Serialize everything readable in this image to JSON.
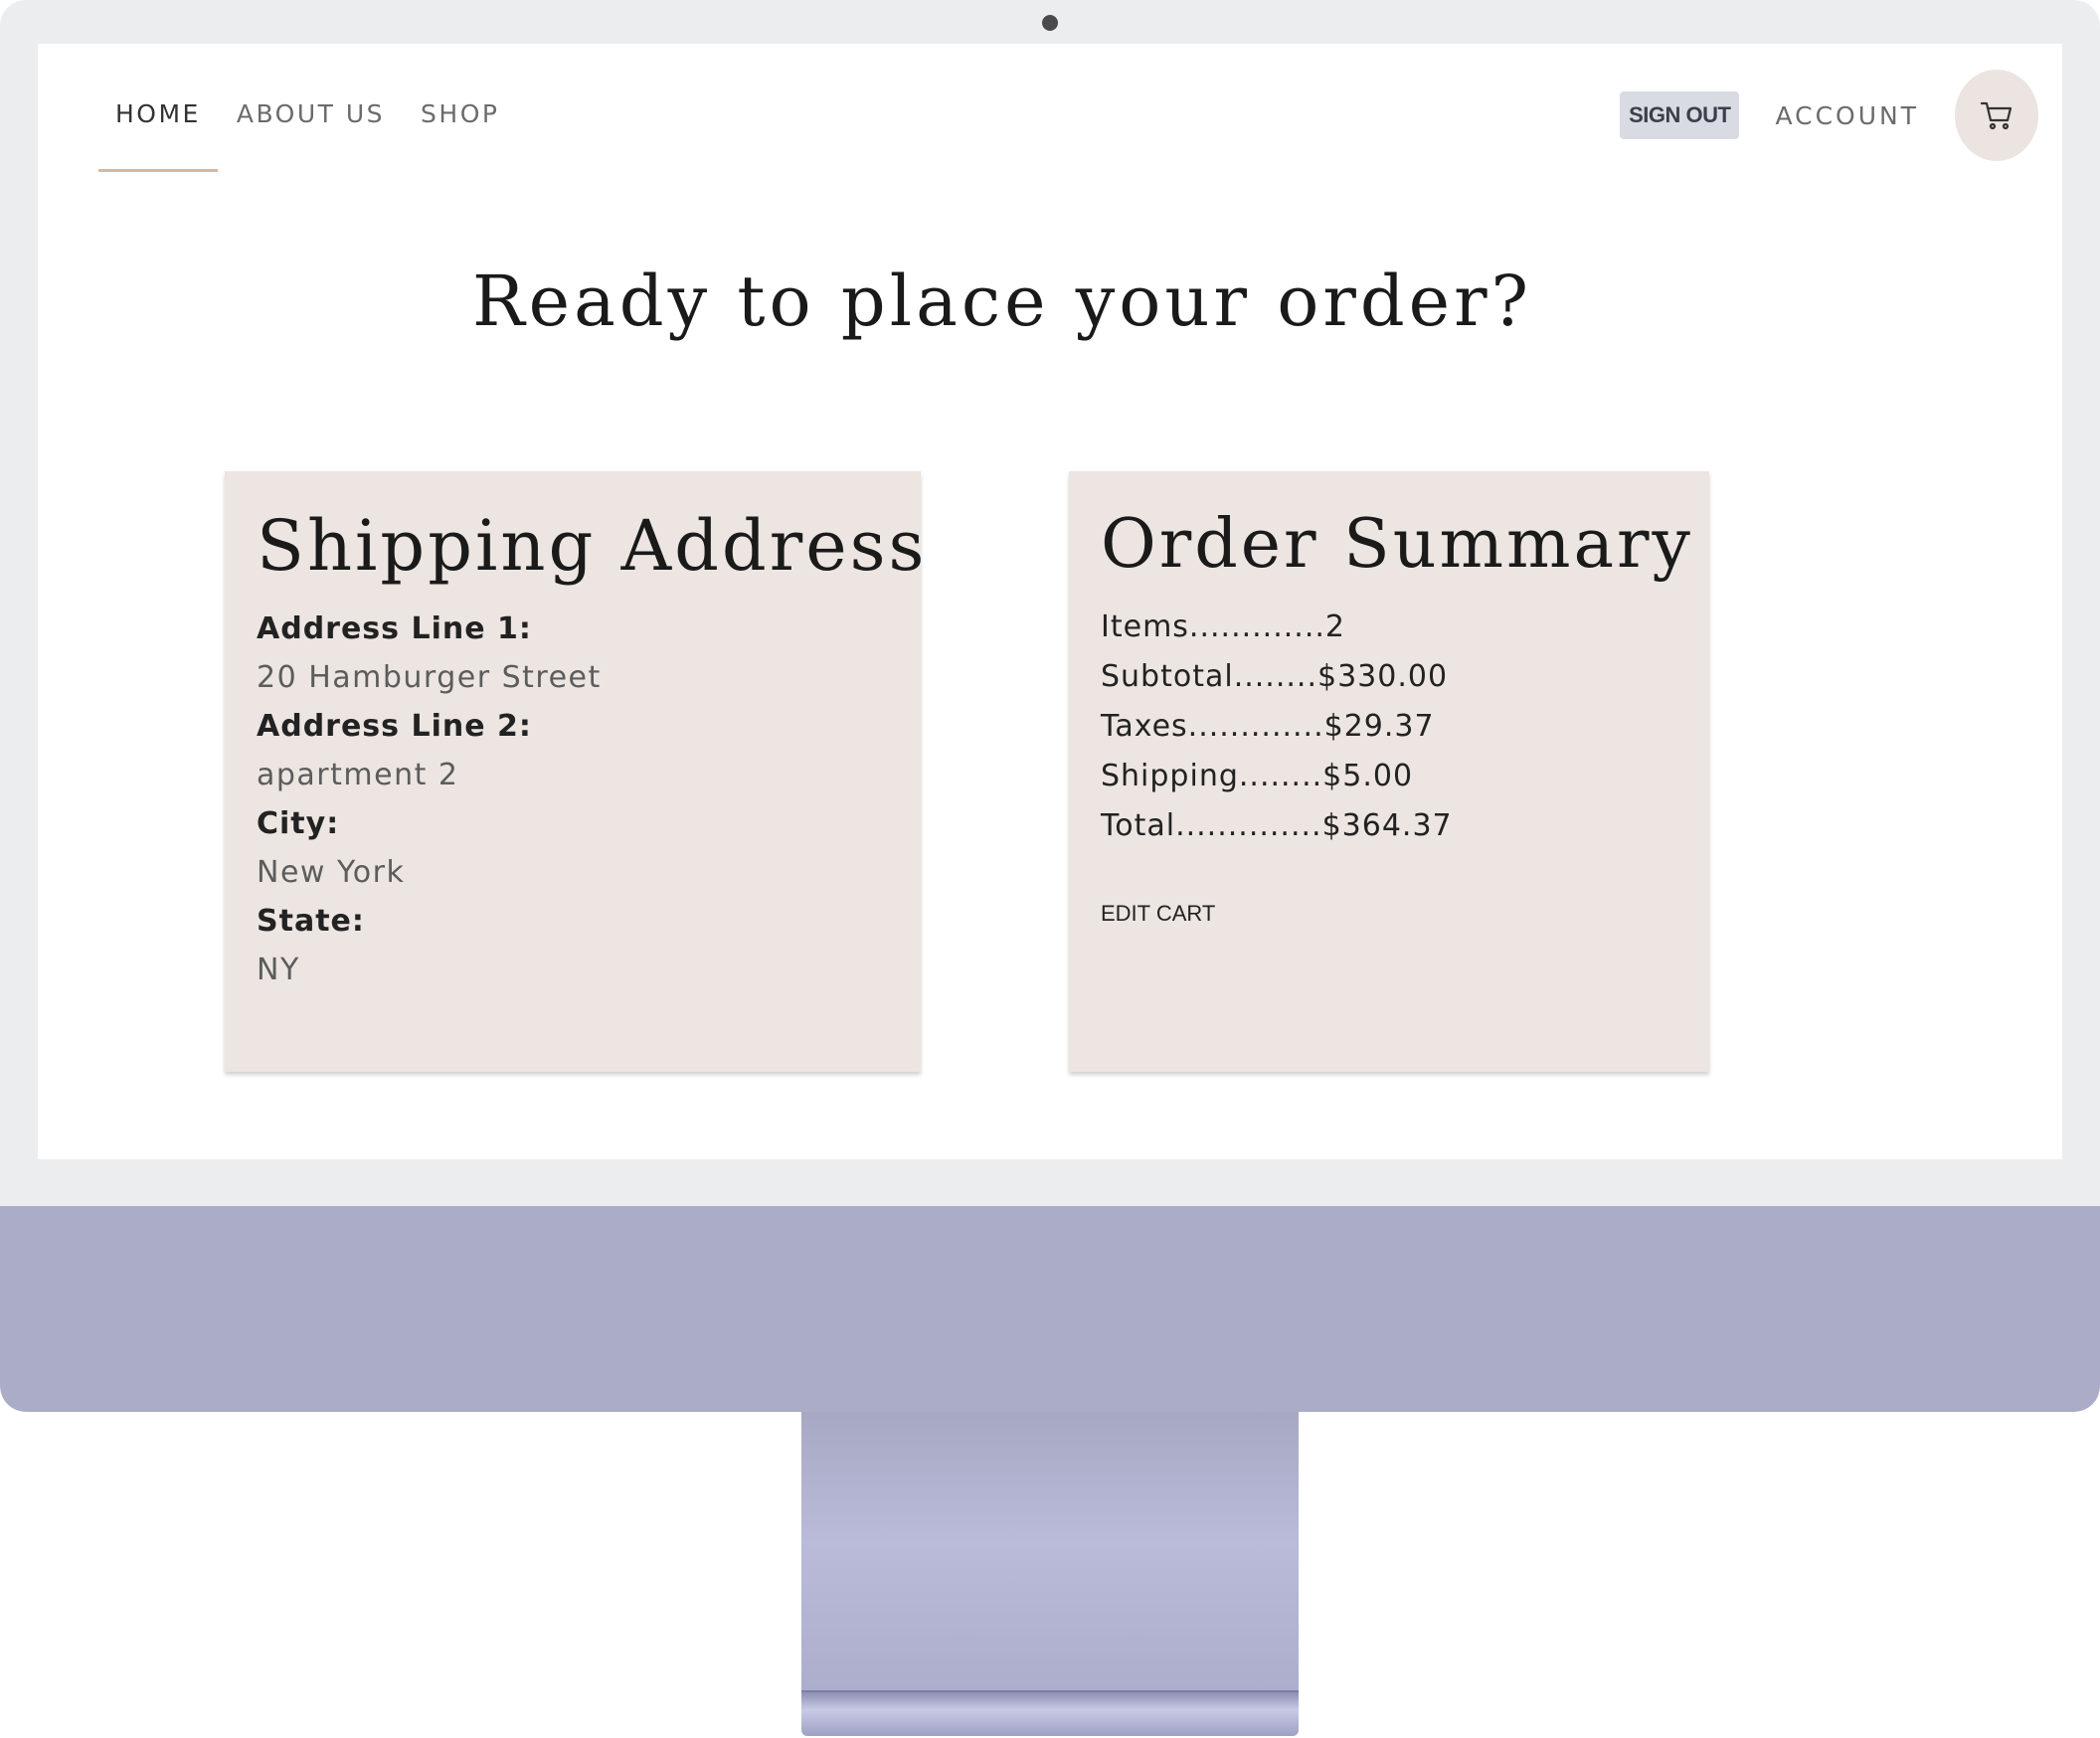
{
  "nav": {
    "left_items": [
      {
        "label": "HOME",
        "active": true
      },
      {
        "label": "ABOUT US",
        "active": false
      },
      {
        "label": "SHOP",
        "active": false
      }
    ],
    "sign_out_label": "SIGN OUT",
    "account_label": "ACCOUNT",
    "cart_icon": "cart-icon"
  },
  "main": {
    "title": "Ready to place your order?"
  },
  "shipping": {
    "title": "Shipping Address",
    "fields": [
      {
        "label": "Address Line 1:",
        "value": "20 Hamburger Street"
      },
      {
        "label": "Address Line 2:",
        "value": "apartment 2"
      },
      {
        "label": "City:",
        "value": "New York"
      },
      {
        "label": "State:",
        "value": "NY"
      }
    ]
  },
  "summary": {
    "title": "Order Summary",
    "rows": [
      "Items.............2",
      "Subtotal........$330.00",
      "Taxes.............$29.37",
      "Shipping........$5.00",
      "Total..............$364.37"
    ],
    "edit_cart_label": "EDIT CART"
  },
  "colors": {
    "bezel": "#ecedef",
    "chin": "#abacc8",
    "card_background": "#ece5e1",
    "nav_underline": "#d7b89a",
    "sign_out_background": "#d8dbe2"
  }
}
